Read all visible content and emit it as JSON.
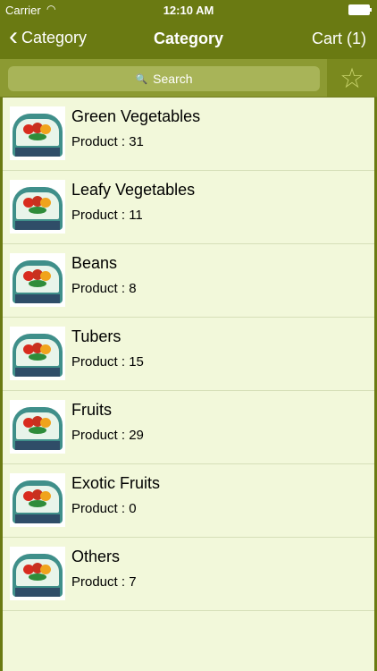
{
  "status_bar": {
    "carrier": "Carrier",
    "time": "12:10 AM"
  },
  "nav": {
    "back_label": "Category",
    "title": "Category",
    "cart_label": "Cart (1)"
  },
  "search": {
    "placeholder": "Search"
  },
  "categories": [
    {
      "name": "Green Vegetables",
      "count_label": "Product : 31"
    },
    {
      "name": "Leafy Vegetables",
      "count_label": "Product : 11"
    },
    {
      "name": "Beans",
      "count_label": "Product : 8"
    },
    {
      "name": "Tubers",
      "count_label": "Product : 15"
    },
    {
      "name": "Fruits",
      "count_label": "Product : 29"
    },
    {
      "name": "Exotic Fruits",
      "count_label": "Product : 0"
    },
    {
      "name": "Others",
      "count_label": "Product : 7"
    }
  ],
  "icons": {
    "wifi": "wifi-icon",
    "battery": "battery-icon",
    "back": "chevron-left-icon",
    "search": "search-icon",
    "favorite": "star-icon"
  },
  "colors": {
    "nav": "#6a7a12",
    "search_bar": "#8c9a32",
    "list_background": "#f2f8da",
    "favorite_star": "#c8d36b"
  }
}
